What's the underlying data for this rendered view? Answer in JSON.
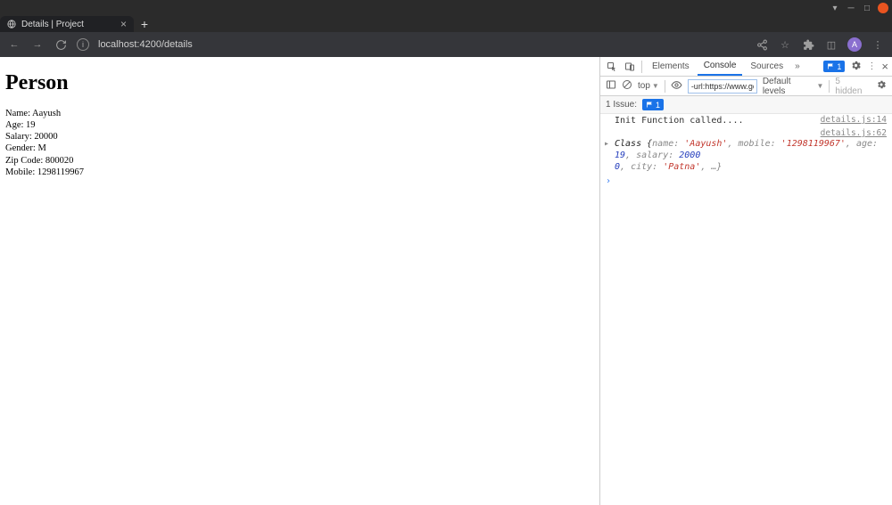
{
  "browser": {
    "tab_title": "Details | Project",
    "url": "localhost:4200/details"
  },
  "page": {
    "heading": "Person",
    "lines": {
      "name": "Name: Aayush",
      "age": "Age: 19",
      "salary": "Salary: 20000",
      "gender": "Gender: M",
      "zip": "Zip Code: 800020",
      "mobile": "Mobile: 1298119967"
    }
  },
  "devtools": {
    "tabs": {
      "elements": "Elements",
      "console": "Console",
      "sources": "Sources"
    },
    "error_count": "1",
    "toolbar": {
      "context": "top",
      "filter_value": "-url:https://www.ge",
      "levels": "Default levels",
      "hidden": "5 hidden"
    },
    "issues": {
      "label": "1 Issue:",
      "count": "1"
    },
    "logs": {
      "l1_src": "details.js:14",
      "l1_msg": "Init Function called....",
      "l2_src": "details.js:62",
      "l2_kw": "Class ",
      "l2_open": "{",
      "l2_p1": "name: ",
      "l2_v1": "'Aayush'",
      "l2_c1": ", ",
      "l2_p2": "mobile: ",
      "l2_v2": "'1298119967'",
      "l2_c2": ", ",
      "l2_p3": "age: ",
      "l2_v3": "19",
      "l2_c3": ", ",
      "l2_p4": "salary: ",
      "l2_v4a": "2000",
      "l2_v4b": "0",
      "l2_c4": ", ",
      "l2_p5": "city: ",
      "l2_v5": "'Patna'",
      "l2_rest": ", …}"
    }
  }
}
